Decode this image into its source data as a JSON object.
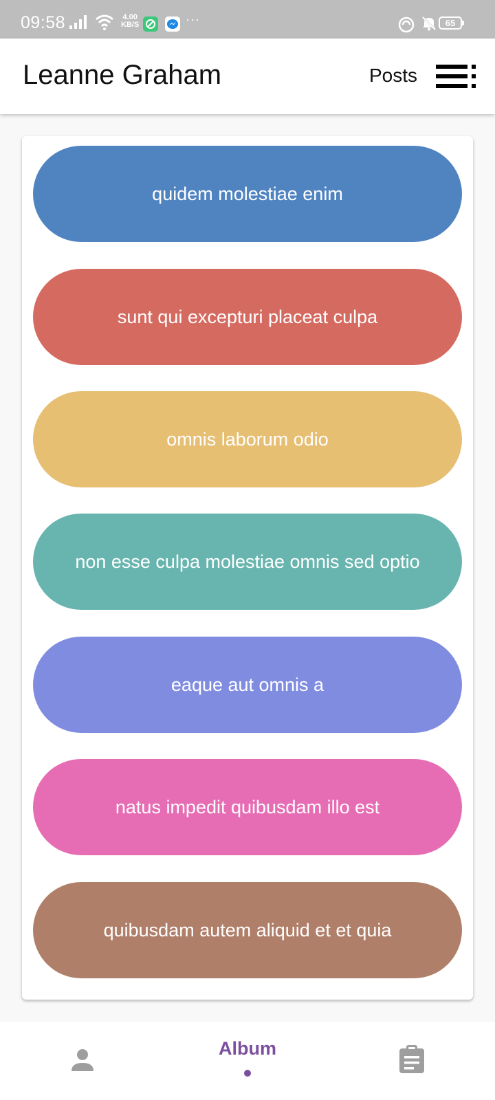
{
  "status_bar": {
    "time": "09:58",
    "net_speed_value": "4.00",
    "net_speed_unit": "KB/S",
    "more": "···",
    "battery": "65",
    "icons": [
      "signal-icon",
      "wifi-icon",
      "app-notification-icon",
      "messenger-icon",
      "data-saver-icon",
      "mute-icon",
      "battery-icon"
    ]
  },
  "app_bar": {
    "title": "Leanne Graham",
    "posts_label": "Posts",
    "menu_icon": "menu-icon"
  },
  "albums": [
    {
      "title": "quidem molestiae enim",
      "color": "#4f84c1"
    },
    {
      "title": "sunt qui excepturi placeat culpa",
      "color": "#d56a61"
    },
    {
      "title": "omnis laborum odio",
      "color": "#e6bf73"
    },
    {
      "title": "non esse culpa molestiae omnis sed optio",
      "color": "#68b4ae"
    },
    {
      "title": "eaque aut omnis a",
      "color": "#808ce0"
    },
    {
      "title": "natus impedit quibusdam illo est",
      "color": "#e66db4"
    },
    {
      "title": "quibusdam autem aliquid et et quia",
      "color": "#b07f69"
    }
  ],
  "bottom_nav": {
    "items": [
      {
        "name": "profile",
        "icon": "person-icon",
        "label": ""
      },
      {
        "name": "album",
        "icon": "",
        "label": "Album",
        "selected": true
      },
      {
        "name": "posts",
        "icon": "clipboard-icon",
        "label": ""
      }
    ],
    "active_color": "#7b4f9d",
    "inactive_color": "#9e9e9e"
  }
}
